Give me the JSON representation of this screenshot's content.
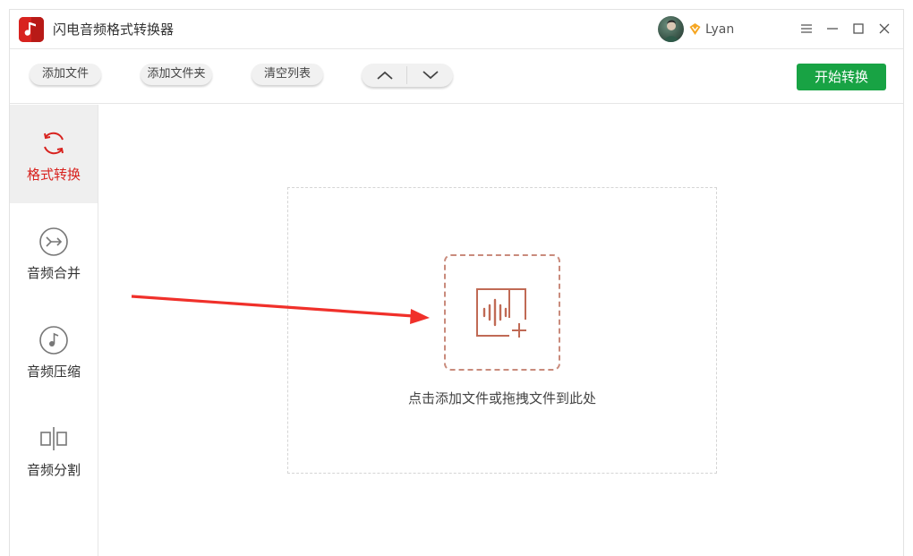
{
  "app": {
    "title": "闪电音频格式转换器",
    "brand_color": "#d8231f",
    "user": {
      "name": "Lyan",
      "badge_icon": "vip-diamond-icon"
    }
  },
  "window_controls": [
    "menu-icon",
    "minimize-icon",
    "maximize-icon",
    "close-icon"
  ],
  "toolbar": {
    "add_file_label": "添加文件",
    "add_folder_label": "添加文件夹",
    "clear_list_label": "清空列表",
    "move_up_icon": "chevron-up-icon",
    "move_down_icon": "chevron-down-icon",
    "start_label": "开始转换",
    "start_color": "#18a344"
  },
  "sidebar": {
    "items": [
      {
        "label": "格式转换",
        "icon": "refresh-icon",
        "active": true
      },
      {
        "label": "音频合并",
        "icon": "merge-icon",
        "active": false
      },
      {
        "label": "音频压缩",
        "icon": "music-note-icon",
        "active": false
      },
      {
        "label": "音频分割",
        "icon": "split-icon",
        "active": false
      }
    ]
  },
  "main": {
    "drop_hint": "点击添加文件或拖拽文件到此处",
    "add_icon": "add-audio-icon"
  }
}
